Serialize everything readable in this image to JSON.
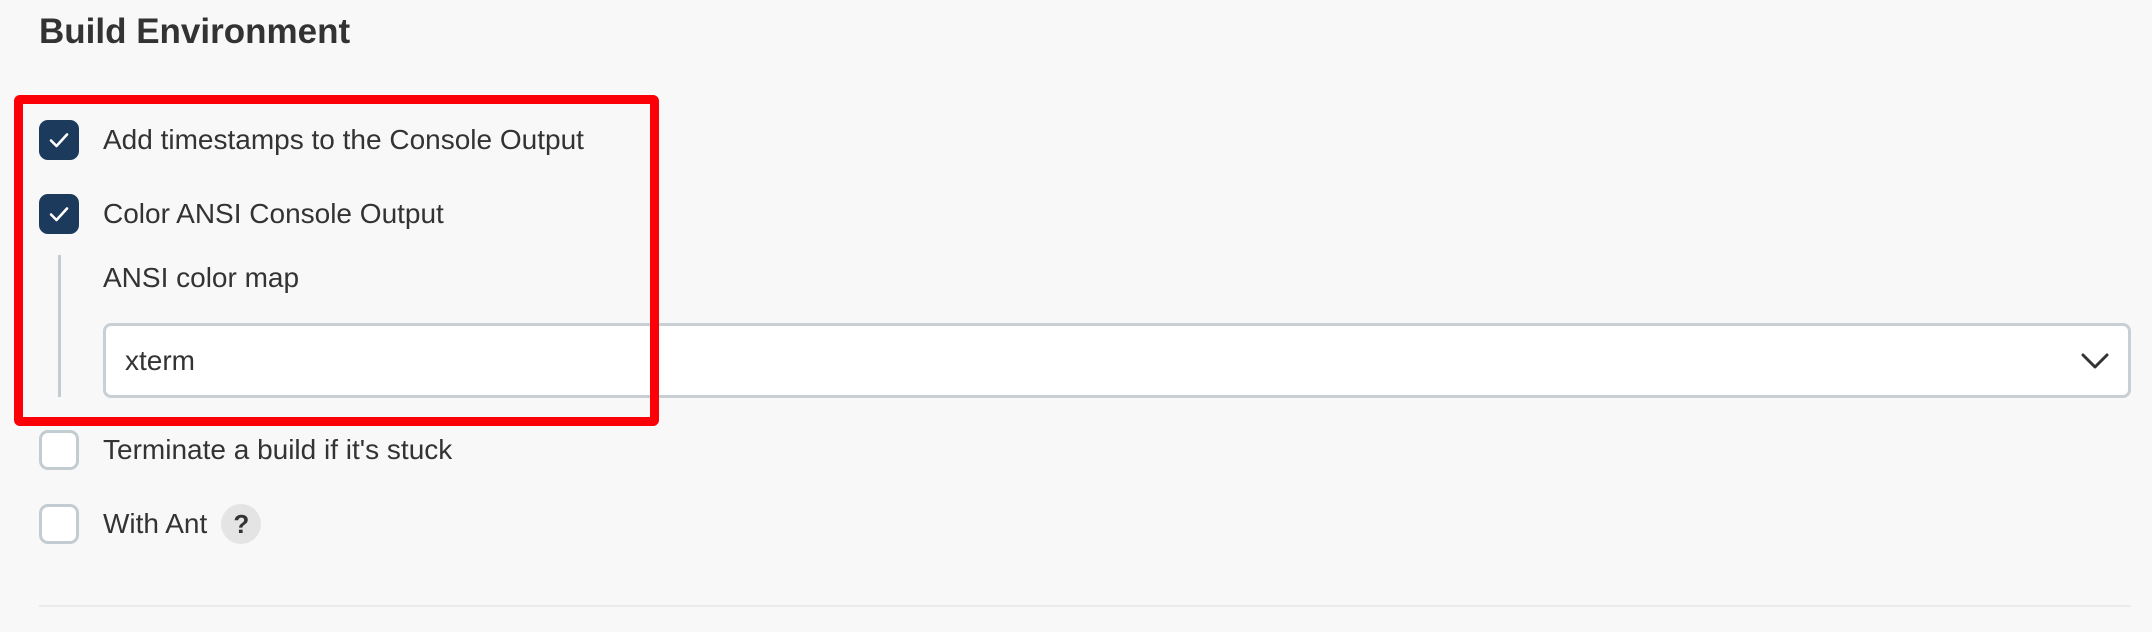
{
  "section": {
    "title": "Build Environment"
  },
  "options": {
    "timestamps": {
      "label": "Add timestamps to the Console Output",
      "checked": true
    },
    "ansi_color": {
      "label": "Color ANSI Console Output",
      "checked": true
    },
    "terminate_stuck": {
      "label": "Terminate a build if it's stuck",
      "checked": false
    },
    "with_ant": {
      "label": "With Ant",
      "checked": false,
      "help": "?"
    }
  },
  "ansi_color_map": {
    "label": "ANSI color map",
    "selected": "xterm"
  },
  "icons": {
    "check": "check-icon",
    "dropdown": "chevron-down-icon",
    "help": "help-icon"
  },
  "colors": {
    "checkbox_checked": "#1c3b5c",
    "checkbox_border": "#c3ccd1",
    "highlight": "#fb0007",
    "background": "#f8f8f8"
  }
}
